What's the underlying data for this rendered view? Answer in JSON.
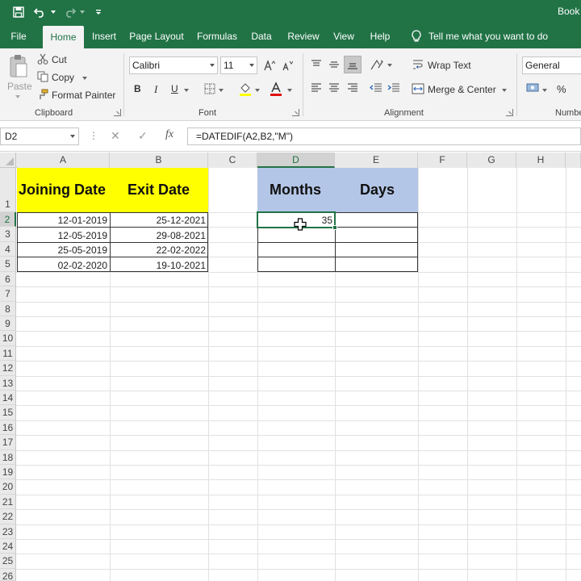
{
  "titlebar": {
    "title": "Book",
    "bg_color": "#217346",
    "qat": [
      "save-icon",
      "undo-icon",
      "redo-icon",
      "customize-qat-icon"
    ]
  },
  "tabs": [
    "File",
    "Home",
    "Insert",
    "Page Layout",
    "Formulas",
    "Data",
    "Review",
    "View",
    "Help"
  ],
  "active_tab": "Home",
  "tell_me": "Tell me what you want to do",
  "ribbon": {
    "clipboard": {
      "paste": "Paste",
      "cut": "Cut",
      "copy": "Copy",
      "format_painter": "Format Painter",
      "label": "Clipboard"
    },
    "font": {
      "name": "Calibri",
      "size": "11",
      "bold": "B",
      "italic": "I",
      "underline": "U",
      "label": "Font"
    },
    "alignment": {
      "wrap_text": "Wrap Text",
      "merge_center": "Merge & Center",
      "label": "Alignment"
    },
    "number": {
      "format": "General",
      "percent": "%",
      "label": "Numbe"
    }
  },
  "formula_bar": {
    "name_box": "D2",
    "fx": "fx",
    "formula": "=DATEDIF(A2,B2,\"M\")"
  },
  "grid": {
    "columns": [
      "A",
      "B",
      "C",
      "D",
      "E",
      "F",
      "G",
      "H"
    ],
    "rows": [
      "1",
      "2",
      "3",
      "4",
      "5",
      "6",
      "7",
      "8",
      "9",
      "10",
      "11",
      "12",
      "13",
      "14",
      "15",
      "16",
      "17",
      "18",
      "19",
      "20",
      "21",
      "22",
      "23",
      "24",
      "25",
      "26"
    ],
    "selected_cell": "D2",
    "headers": {
      "a1": "Joining Date",
      "b1": "Exit Date",
      "d1": "Months",
      "e1": "Days"
    },
    "table": [
      {
        "joining": "12-01-2019",
        "exit": "25-12-2021"
      },
      {
        "joining": "12-05-2019",
        "exit": "29-08-2021"
      },
      {
        "joining": "25-05-2019",
        "exit": "22-02-2022"
      },
      {
        "joining": "02-02-2020",
        "exit": "19-10-2021"
      }
    ],
    "d2_value": "35",
    "colors": {
      "yellow": "#ffff00",
      "blue": "#b4c6e7",
      "selection": "#217346"
    }
  }
}
